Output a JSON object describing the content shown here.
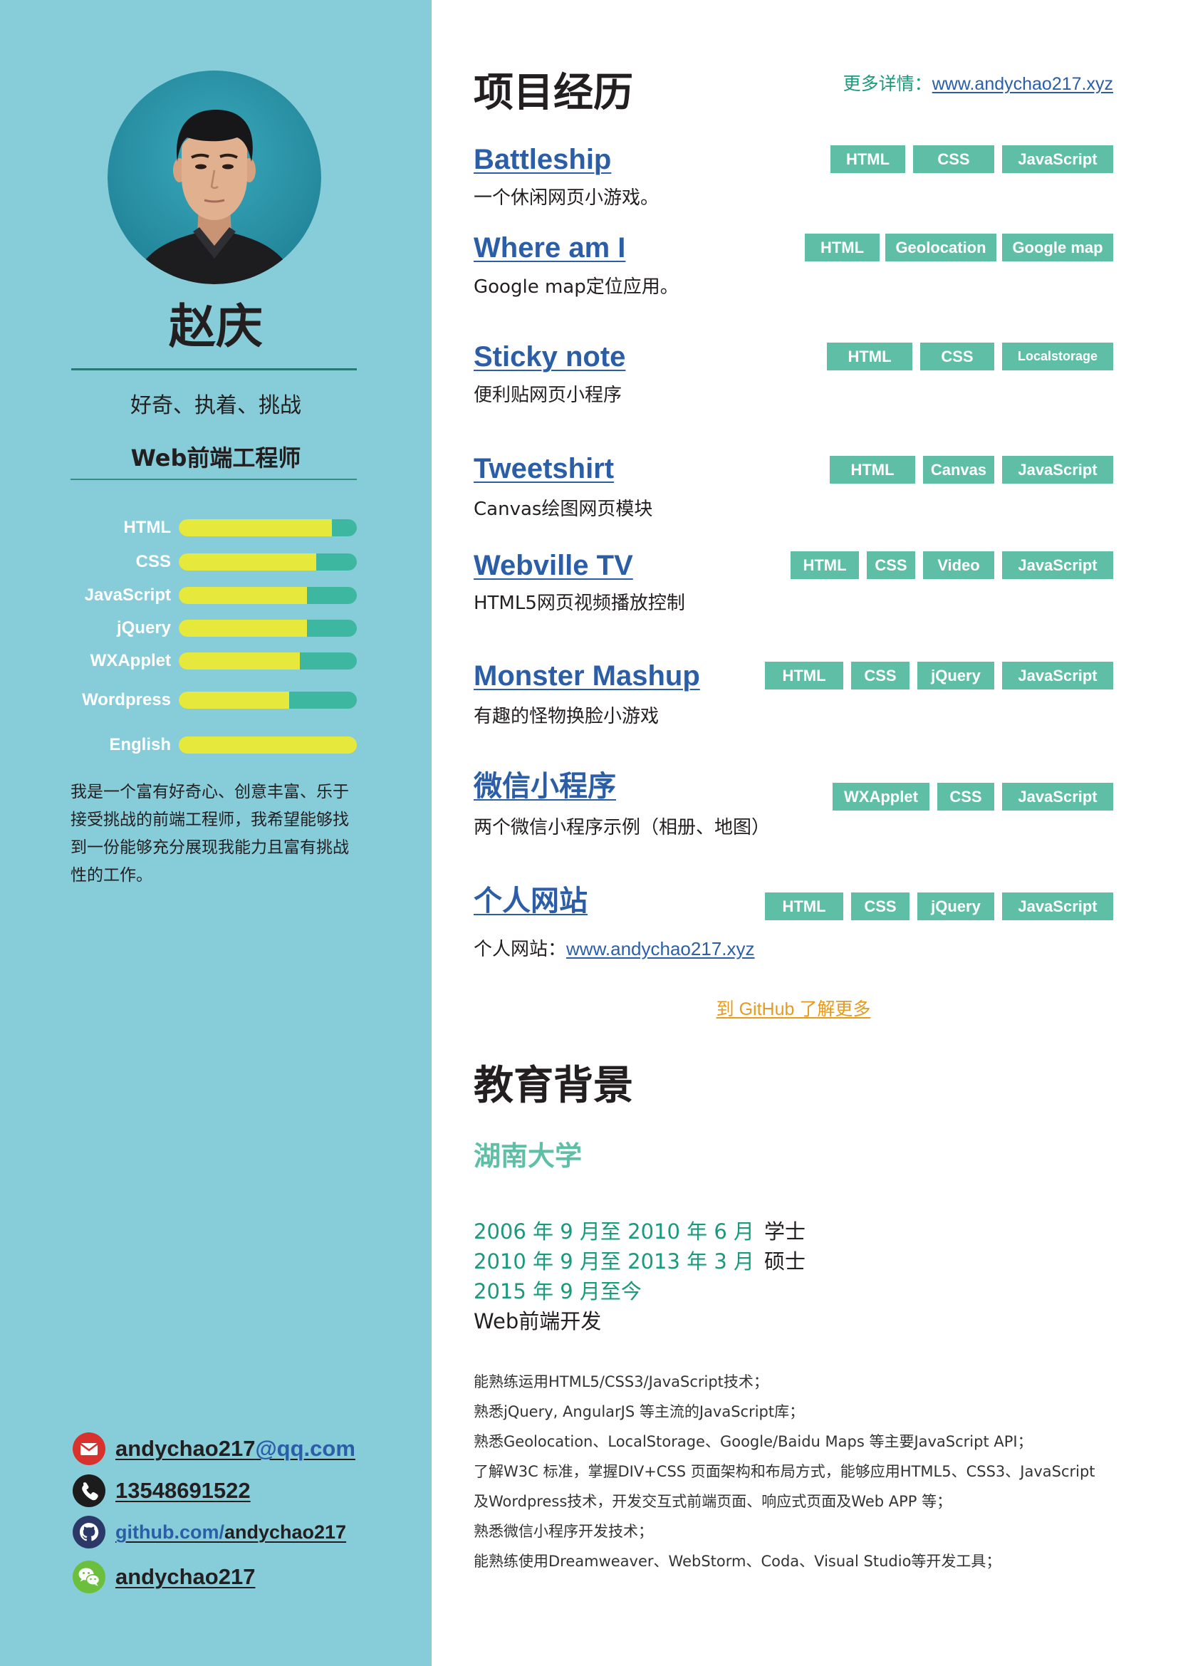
{
  "colors": {
    "sidebar_bg": "#87cdd9",
    "name_rule": "#1f7f6c",
    "skill_fill": "#e6e83b",
    "skill_track": "#3db7a0",
    "project_title": "#2b5ea7",
    "tag_bg": "#5fbfa6",
    "accent_teal": "#1a9a7c",
    "link_blue": "#2b5ea7",
    "github_link": "#e89a1c",
    "email_icon": "#d8322e",
    "phone_icon": "#1c1c1c",
    "github_icon": "#2c3868",
    "wechat_icon": "#6cbf3c"
  },
  "sidebar": {
    "name": "赵庆",
    "motto": "好奇、执着、挑战",
    "role": "Web前端工程师",
    "skills": [
      {
        "label": "HTML",
        "level": 0.86
      },
      {
        "label": "CSS",
        "level": 0.77
      },
      {
        "label": "JavaScript",
        "level": 0.72
      },
      {
        "label": "jQuery",
        "level": 0.72
      },
      {
        "label": "WXApplet",
        "level": 0.68
      },
      {
        "label": "Wordpress",
        "level": 0.62
      },
      {
        "label": "English",
        "level": 1.0
      }
    ],
    "bio": "我是一个富有好奇心、创意丰富、乐于接受挑战的前端工程师，我希望能够找到一份能够充分展现我能力且富有挑战性的工作。",
    "contacts": {
      "email": {
        "icon": "mail-icon",
        "user": "andychao217",
        "domain": "@qq.com"
      },
      "phone": {
        "icon": "phone-icon",
        "number": "13548691522"
      },
      "github": {
        "icon": "github-icon",
        "host": "github.com/",
        "user": "andychao217"
      },
      "wechat": {
        "icon": "wechat-icon",
        "id": "andychao217"
      }
    }
  },
  "projects": {
    "heading": "项目经历",
    "more_label": "更多详情：",
    "more_link": "www.andychao217.xyz",
    "items": [
      {
        "title": "Battleship",
        "desc": "一个休闲网页小游戏。",
        "tags": [
          "HTML",
          "CSS",
          "JavaScript"
        ]
      },
      {
        "title": "Where am I",
        "desc": "Google map定位应用。",
        "tags": [
          "HTML",
          "Geolocation",
          "Google map"
        ]
      },
      {
        "title": "Sticky note",
        "desc": "便利贴网页小程序",
        "tags": [
          "HTML",
          "CSS",
          "Localstorage"
        ]
      },
      {
        "title": "Tweetshirt",
        "desc": "Canvas绘图网页模块",
        "tags": [
          "HTML",
          "Canvas",
          "JavaScript"
        ]
      },
      {
        "title": "Webville TV",
        "desc": "HTML5网页视频播放控制",
        "tags": [
          "HTML",
          "CSS",
          "Video",
          "JavaScript"
        ]
      },
      {
        "title": "Monster Mashup",
        "desc": "有趣的怪物换脸小游戏",
        "tags": [
          "HTML",
          "CSS",
          "jQuery",
          "JavaScript"
        ]
      },
      {
        "title": "微信小程序",
        "desc": "两个微信小程序示例（相册、地图）",
        "tags": [
          "WXApplet",
          "CSS",
          "JavaScript"
        ]
      },
      {
        "title": "个人网站",
        "desc": "个人网站：",
        "desc_link": "www.andychao217.xyz",
        "tags": [
          "HTML",
          "CSS",
          "jQuery",
          "JavaScript"
        ]
      }
    ],
    "github_more": "到 GitHub 了解更多"
  },
  "education": {
    "heading": "教育背景",
    "school": "湖南大学",
    "periods": [
      {
        "dates": "2006 年 9 月至 2010 年 6 月",
        "degree": "学士"
      },
      {
        "dates": "2010 年 9 月至 2013 年 3 月",
        "degree": "硕士"
      },
      {
        "dates": "2015 年 9 月至今"
      }
    ],
    "current_work": "Web前端开发",
    "abilities": [
      "能熟练运用HTML5/CSS3/JavaScript技术；",
      "熟悉jQuery, AngularJS 等主流的JavaScript库；",
      "熟悉Geolocation、LocalStorage、Google/Baidu Maps 等主要JavaScript API；",
      "了解W3C 标准，掌握DIV+CSS 页面架构和布局方式，能够应用HTML5、CSS3、JavaScript及Wordpress技术，开发交互式前端页面、响应式页面及Web APP 等；",
      "熟悉微信小程序开发技术；",
      "能熟练使用Dreamweaver、WebStorm、Coda、Visual Studio等开发工具；"
    ]
  }
}
